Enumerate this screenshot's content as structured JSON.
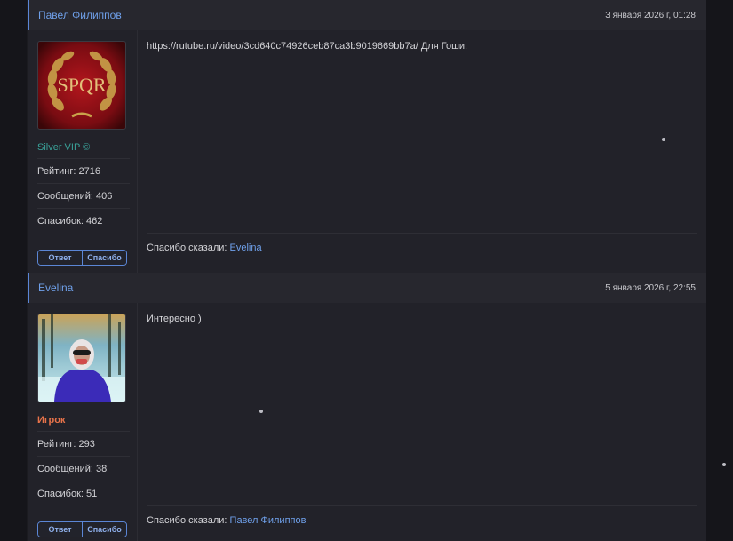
{
  "posts": [
    {
      "author": "Павел Филиппов",
      "date": "3 января 2026 г, 01:28",
      "rank": "Silver VIP ©",
      "rank_color": "#3aa39a",
      "rating": "Рейтинг: 2716",
      "messages": "Сообщений: 406",
      "thanks": "Спасибок: 462",
      "text": "https://rutube.ru/video/3cd640c74926ceb87ca3b9019669bb7a/ Для Гоши.",
      "thanks_label": "Спасибо сказали:",
      "thanks_names": "Evelina",
      "reply_label": "Ответ",
      "thank_btn_label": "Спасибо"
    },
    {
      "author": "Evelina",
      "date": "5 января 2026 г, 22:55",
      "rank": "Игрок",
      "rank_color": "#e8734a",
      "rating": "Рейтинг: 293",
      "messages": "Сообщений: 38",
      "thanks": "Спасибок: 51",
      "text": "Интересно )",
      "thanks_label": "Спасибо сказали:",
      "thanks_names": "Павел Филиппов",
      "reply_label": "Ответ",
      "thank_btn_label": "Спасибо"
    }
  ],
  "avatar_spqr_text": "SPQR",
  "colors": {
    "accent": "#5b86d6",
    "link": "#6fa0ea",
    "background": "#222229"
  }
}
